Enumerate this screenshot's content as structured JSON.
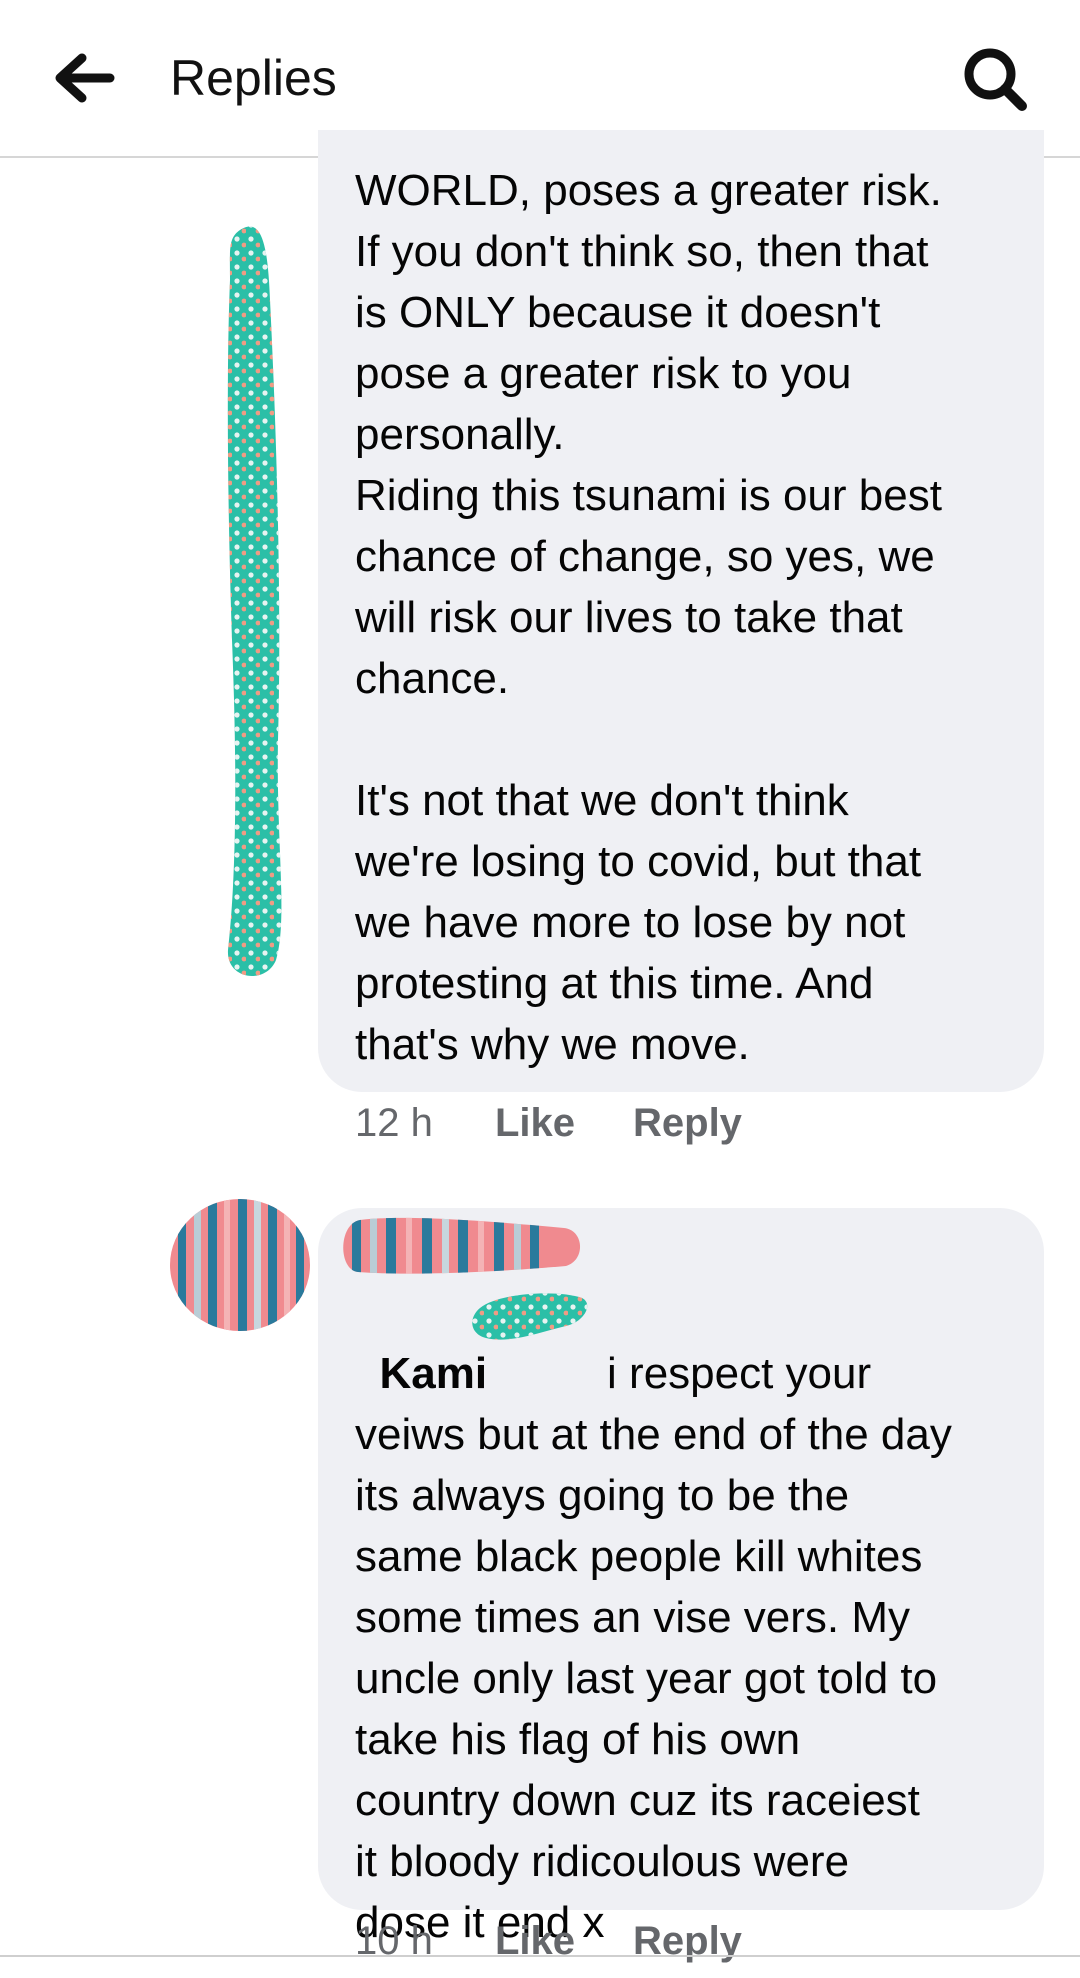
{
  "header": {
    "title": "Replies",
    "back_icon": "arrow-left-icon",
    "search_icon": "search-icon"
  },
  "comments": [
    {
      "text": "WORLD, poses a greater risk.\nIf you don't think so, then that\nis ONLY because it doesn't\npose a greater risk to you\npersonally.\nRiding this tsunami is our best\nchance of change, so yes, we\nwill risk our lives to take that\nchance.\n\nIt's not that we don't think\nwe're losing to covid, but that\nwe have more to lose by not\nprotesting at this time. And\nthat's why we move.",
      "time": "12 h",
      "like": "Like",
      "reply": "Reply"
    },
    {
      "mention": "Kami",
      "text": "i respect your\nveiws but at the end of the day\nits always going to be the\nsame black people kill whites\nsome times an vise vers. My\nuncle only last year got told to\ntake his flag of his own\ncountry down cuz its raceiest\nit bloody ridicoulous were\ndose it end x",
      "time": "10 h",
      "like": "Like",
      "reply": "Reply"
    }
  ],
  "colors": {
    "bubble": "#eff0f4",
    "meta": "#65676b",
    "teal": "#2bbfa7",
    "stripe_pink": "#f08a8f",
    "stripe_blue": "#2a7a9c"
  }
}
